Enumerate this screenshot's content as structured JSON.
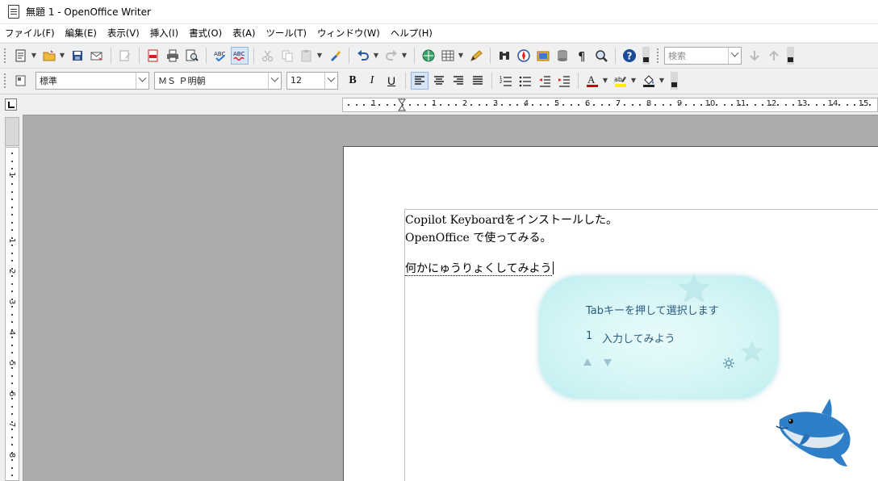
{
  "window": {
    "title": "無題 1 - OpenOffice Writer"
  },
  "menu": {
    "items": [
      "ファイル(F)",
      "編集(E)",
      "表示(V)",
      "挿入(I)",
      "書式(O)",
      "表(A)",
      "ツール(T)",
      "ウィンドウ(W)",
      "ヘルプ(H)"
    ]
  },
  "toolbar_standard": {
    "search_placeholder": "検索"
  },
  "toolbar_format": {
    "paragraph_style": "標準",
    "font_name": "ＭＳ Ｐ明朝",
    "font_size": "12",
    "bold": "B",
    "italic": "I",
    "underline": "U"
  },
  "ruler": {
    "h_labels": [
      "1",
      "1",
      "2",
      "3",
      "4",
      "5",
      "6",
      "7",
      "8",
      "9",
      "10",
      "11",
      "12",
      "13",
      "14",
      "15"
    ],
    "v_labels": [
      "1",
      "1",
      "2",
      "3",
      "4",
      "5",
      "6",
      "7",
      "8"
    ]
  },
  "document": {
    "lines": [
      "Copilot Keyboardをインストールした。",
      "OpenOffice で使ってみる。"
    ],
    "composing_text": "何かにゅうりょくしてみよう"
  },
  "ime_popup": {
    "hint": "Tabキーを押して選択します",
    "candidates": [
      {
        "number": "1",
        "text": "入力してみよう"
      }
    ]
  },
  "colors": {
    "accent": "#2a5a7c",
    "popup_bg": "#d5f5f6",
    "canvas": "#acacac"
  }
}
